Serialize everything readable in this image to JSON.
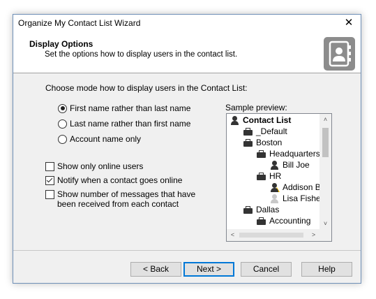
{
  "window": {
    "title": "Organize My Contact List Wizard",
    "close_glyph": "✕"
  },
  "header": {
    "title": "Display Options",
    "subtitle": "Set the options how to display users in the contact list."
  },
  "content": {
    "prompt": "Choose mode how to display users in the Contact List:",
    "display_modes": [
      {
        "label": "First name rather than last name",
        "selected": true
      },
      {
        "label": "Last name rather than first name",
        "selected": false
      },
      {
        "label": "Account name only",
        "selected": false
      }
    ],
    "options": [
      {
        "label": "Show only online users",
        "checked": false
      },
      {
        "label": "Notify when a contact goes online",
        "checked": true
      },
      {
        "label": "Show number of messages that have been received from each contact",
        "checked": false
      }
    ],
    "preview": {
      "label": "Sample preview:",
      "tree": [
        {
          "text": "Contact List",
          "icon": "person-icon",
          "bold": true
        },
        {
          "text": "_Default",
          "icon": "briefcase-icon"
        },
        {
          "text": "Boston",
          "icon": "briefcase-icon"
        },
        {
          "text": "Headquarters",
          "icon": "briefcase-icon"
        },
        {
          "text": "Bill Joe",
          "icon": "person-icon"
        },
        {
          "text": "HR",
          "icon": "briefcase-icon"
        },
        {
          "text": "Addison Ba",
          "icon": "person-away-icon"
        },
        {
          "text": "Lisa Fisher",
          "icon": "person-offline-icon"
        },
        {
          "text": "Dallas",
          "icon": "briefcase-icon"
        },
        {
          "text": "Accounting",
          "icon": "briefcase-icon"
        }
      ],
      "scroll_up": "˄",
      "scroll_down": "˅",
      "scroll_left": "<",
      "scroll_right": ">"
    }
  },
  "buttons": {
    "back": "< Back",
    "next": "Next >",
    "cancel": "Cancel",
    "help": "Help"
  }
}
